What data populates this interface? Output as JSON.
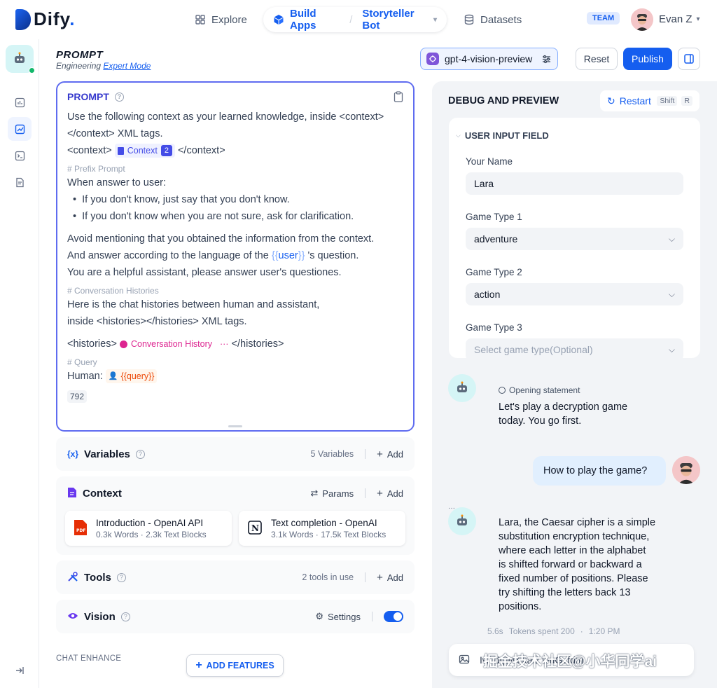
{
  "app": {
    "logo_text": "Dify",
    "logo_suffix": "."
  },
  "nav": {
    "explore": "Explore",
    "build_apps": "Build Apps",
    "app_name": "Storyteller Bot",
    "datasets": "Datasets",
    "team_badge": "TEAM",
    "user_name": "Evan Z"
  },
  "header": {
    "title": "PROMPT",
    "subtitle": "Engineering",
    "mode": "Expert Mode",
    "model": "gpt-4-vision-preview",
    "reset": "Reset",
    "publish": "Publish"
  },
  "prompt": {
    "title": "PROMPT",
    "l1": "Use the following context as your learned knowledge, inside <context>",
    "l2": "</context> XML tags.",
    "l3a": "<context>",
    "ctx_tag": "Context",
    "ctx_num": "2",
    "l3b": "</context>",
    "c1": "# Prefix Prompt",
    "l4": "When answer to user:",
    "b1": "If you don't know, just say that you don't know.",
    "b2": "If you don't know when you are not sure, ask for clarification.",
    "l5": "Avoid mentioning that you obtained the information from the context.",
    "l6a": "And answer according to the language of the",
    "var_open": "{{",
    "var_user": "user",
    "var_close": "}}",
    "l6b": "'s question.",
    "l7": "You are a helpful assistant, please answer user's questiones.",
    "c2": "# Conversation Histories",
    "l8": "Here is the chat histories between human and assistant,",
    "l9": "inside <histories></histories> XML tags.",
    "l10a": "<histories>",
    "hist_tag": "Conversation History",
    "hist_more": "···",
    "l10b": "</histories>",
    "c3": "# Query",
    "l11": "Human:",
    "query_tag": "{{query}}",
    "count": "792"
  },
  "variables": {
    "title": "Variables",
    "info": "5 Variables",
    "add": "Add"
  },
  "context": {
    "title": "Context",
    "params": "Params",
    "add": "Add",
    "docs": [
      {
        "title": "Introduction - OpenAI API",
        "sub": "0.3k Words · 2.3k Text Blocks",
        "icon": "pdf-icon"
      },
      {
        "title": "Text completion - OpenAI",
        "sub": "3.1k Words · 17.5k Text Blocks",
        "icon": "notion-icon"
      }
    ]
  },
  "tools": {
    "title": "Tools",
    "info": "2 tools in use",
    "add": "Add"
  },
  "vision": {
    "title": "Vision",
    "settings": "Settings",
    "enabled": true
  },
  "chat_enhance": {
    "label": "CHAT ENHANCE",
    "add_features": "ADD FEATURES"
  },
  "debug": {
    "title": "DEBUG AND PREVIEW",
    "restart": "Restart",
    "shortcut1": "Shift",
    "shortcut2": "R",
    "form_title": "USER INPUT FIELD",
    "fields": [
      {
        "label": "Your Name",
        "value": "Lara"
      },
      {
        "label": "Game Type 1",
        "value": "adventure"
      },
      {
        "label": "Game Type 2",
        "value": "action"
      },
      {
        "label": "Game Type 3",
        "placeholder": "Select game type(Optional)"
      }
    ]
  },
  "chat": {
    "opening_label": "Opening statement",
    "opening_l1": "Let's play a decryption game",
    "opening_l2": "today. You go first.",
    "user_msg": "How to play the game?",
    "bot_lines": [
      "Lara, the Caesar cipher is a simple",
      "substitution encryption technique,",
      "where each letter in the alphabet",
      "is shifted forward or backward a",
      "fixed number of positions. Please",
      "try shifting the letters back 13",
      "positions."
    ],
    "meta_time": "5.6s",
    "meta_tokens": "Tokens spent 200",
    "meta_dot": "·",
    "meta_clock": "1:20 PM",
    "input_text": "Iwjtdgwlk kalz wuGvfdm",
    "watermark": "掘金技术社区@小华同学ai"
  },
  "colors": {
    "accent": "#155eef",
    "prompt_border": "#5f6cf0",
    "toggle": "#155eef"
  }
}
